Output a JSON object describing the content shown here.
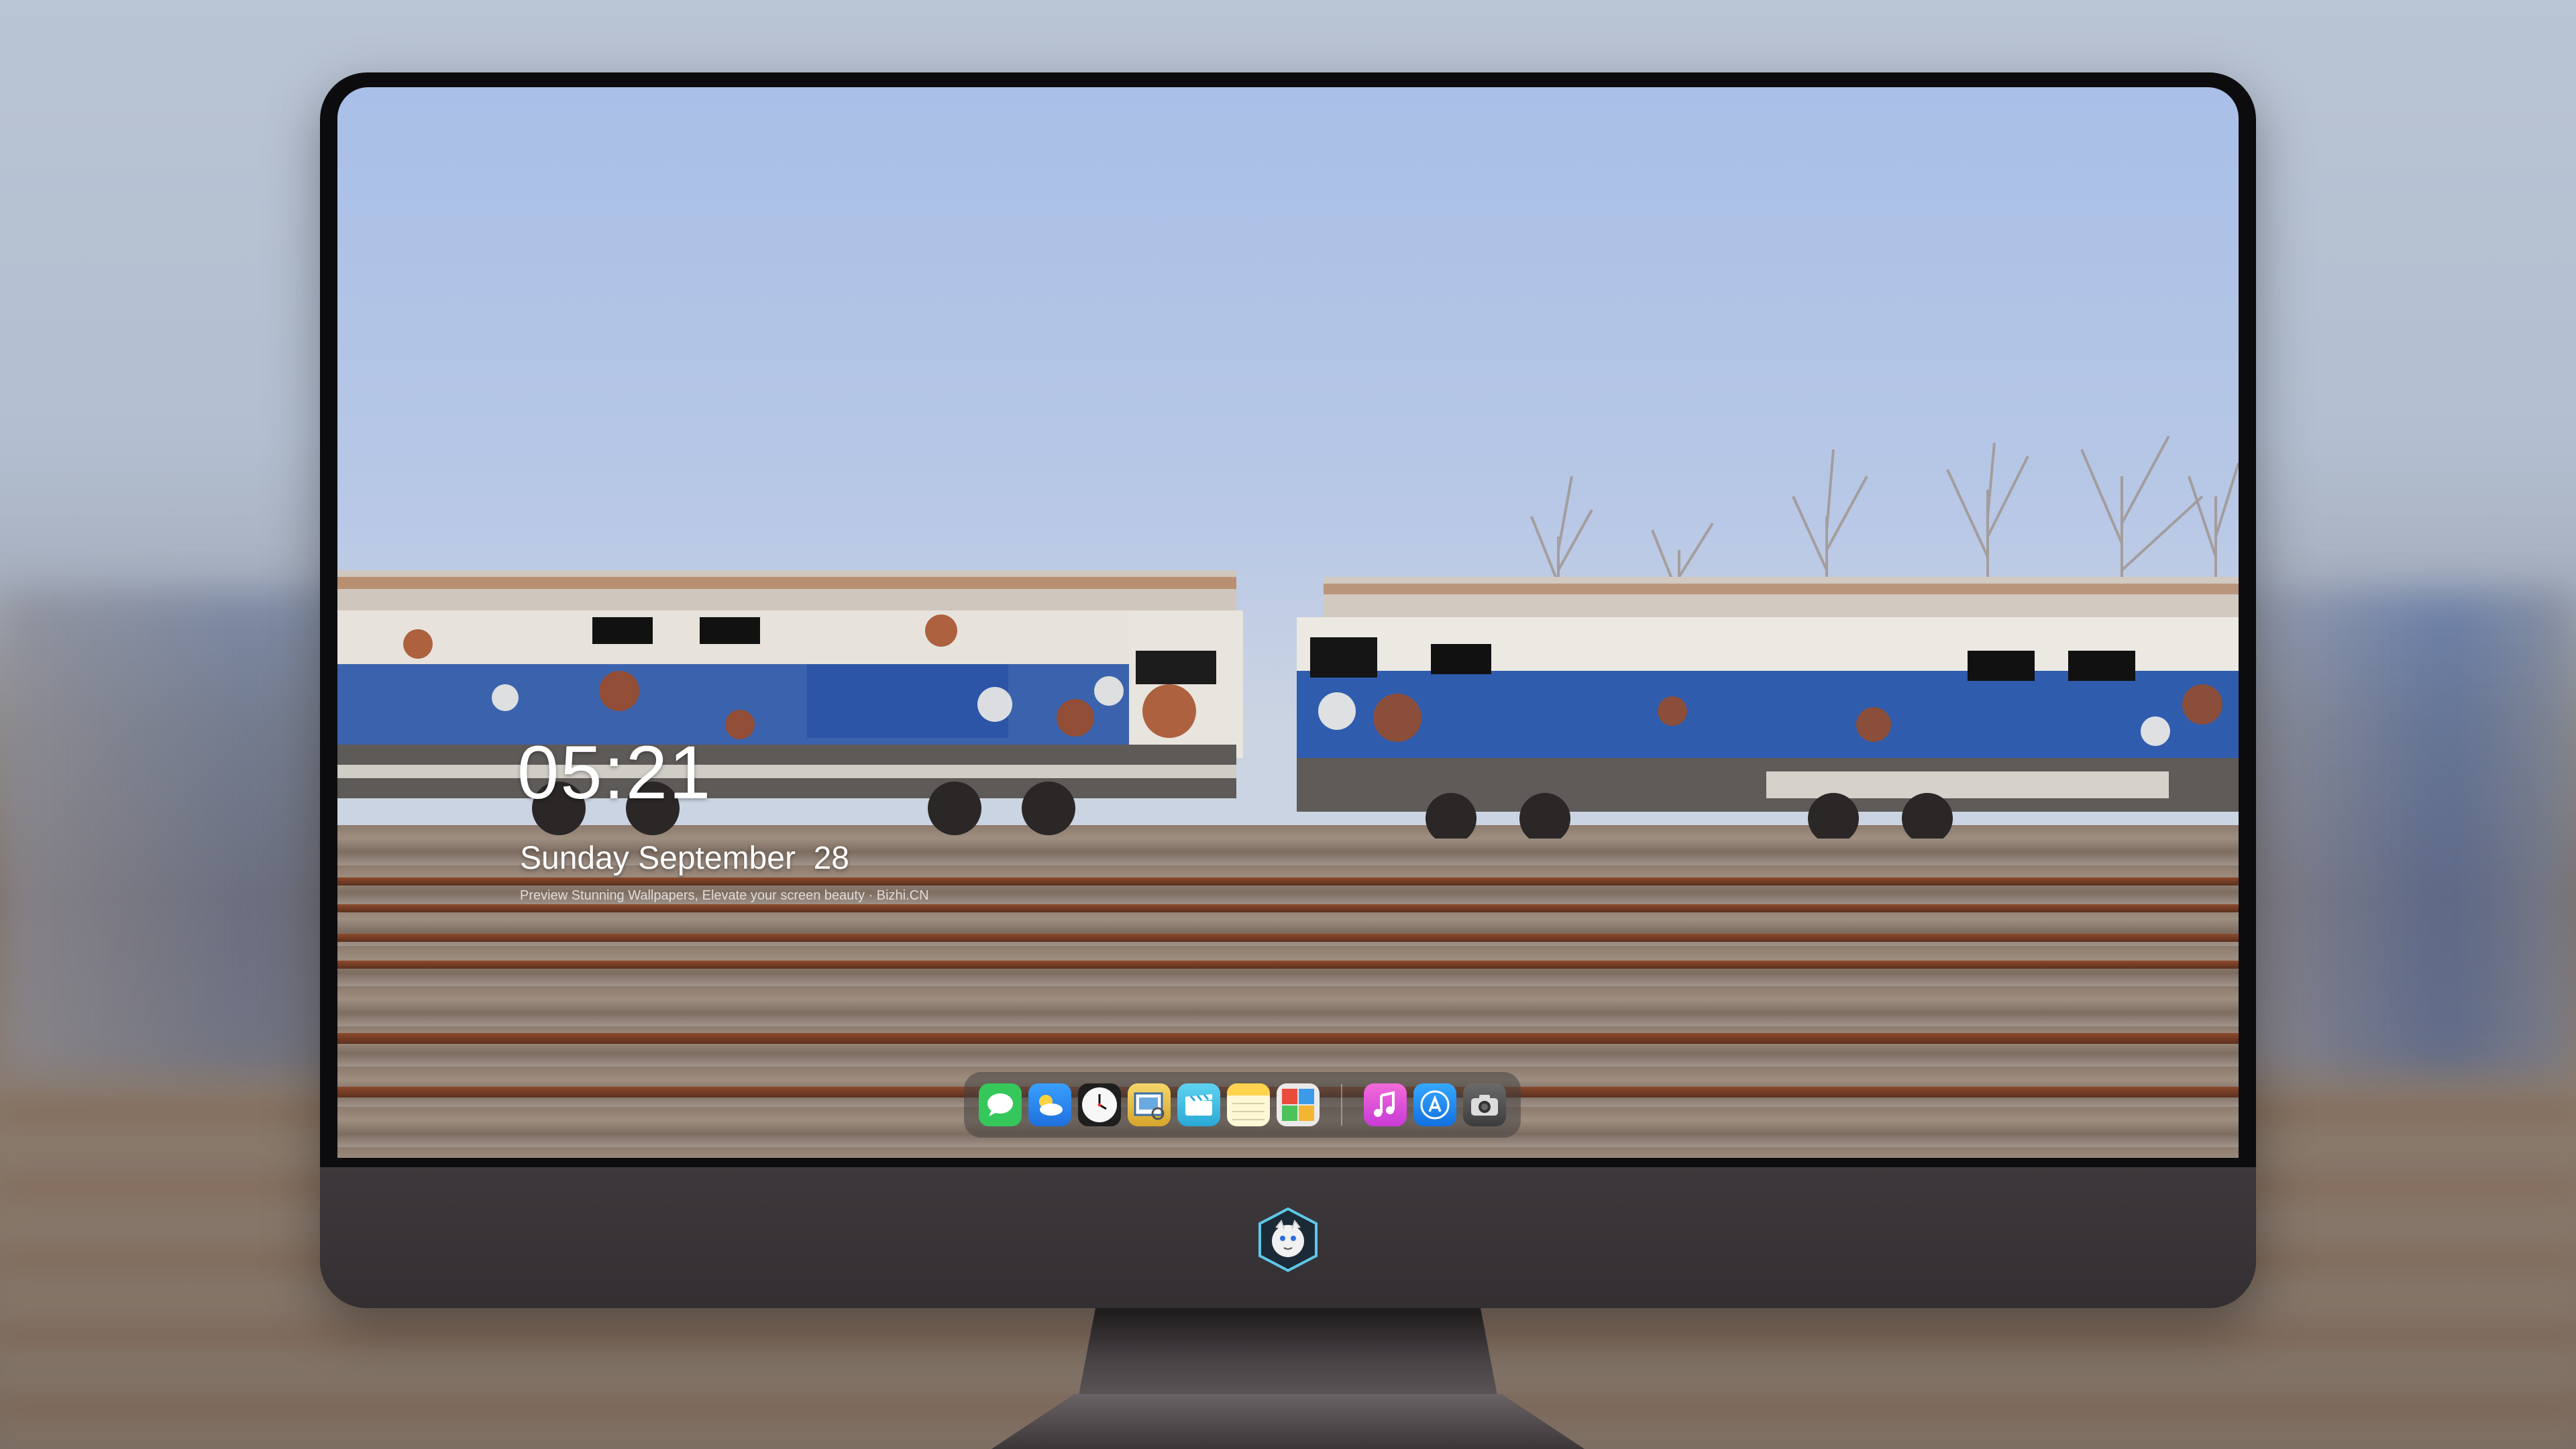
{
  "lock_screen": {
    "time": "05:21",
    "date": "Sunday September  28",
    "tagline": "Preview Stunning Wallpapers, Elevate your screen beauty · Bizhi.CN"
  },
  "dock": {
    "apps": [
      {
        "name": "Messages",
        "icon": "messages-icon",
        "color": "#35c759"
      },
      {
        "name": "Weather",
        "icon": "weather-icon",
        "color": "#2f8cf0"
      },
      {
        "name": "Clock",
        "icon": "clock-icon",
        "color": "#f2f2f2"
      },
      {
        "name": "Preview",
        "icon": "preview-icon",
        "color": "#e8c24a"
      },
      {
        "name": "Clips",
        "icon": "clips-icon",
        "color": "#38c6e6"
      },
      {
        "name": "Notes",
        "icon": "notes-icon",
        "color": "#ffd34d"
      },
      {
        "name": "Photo Booth",
        "icon": "photo-booth-icon",
        "color": "#e0e0e0"
      },
      {
        "name": "iTunes",
        "icon": "itunes-icon",
        "color": "#e34bd3"
      },
      {
        "name": "App Store",
        "icon": "app-store-icon",
        "color": "#1e88f0"
      },
      {
        "name": "Camera",
        "icon": "camera-icon",
        "color": "#4a4a4a"
      }
    ]
  },
  "colors": {
    "bezel": "#0c0c0e",
    "chin": "#3a3538",
    "sky": "#a9bfe7",
    "locomotive_blue": "#2e5aa8"
  }
}
